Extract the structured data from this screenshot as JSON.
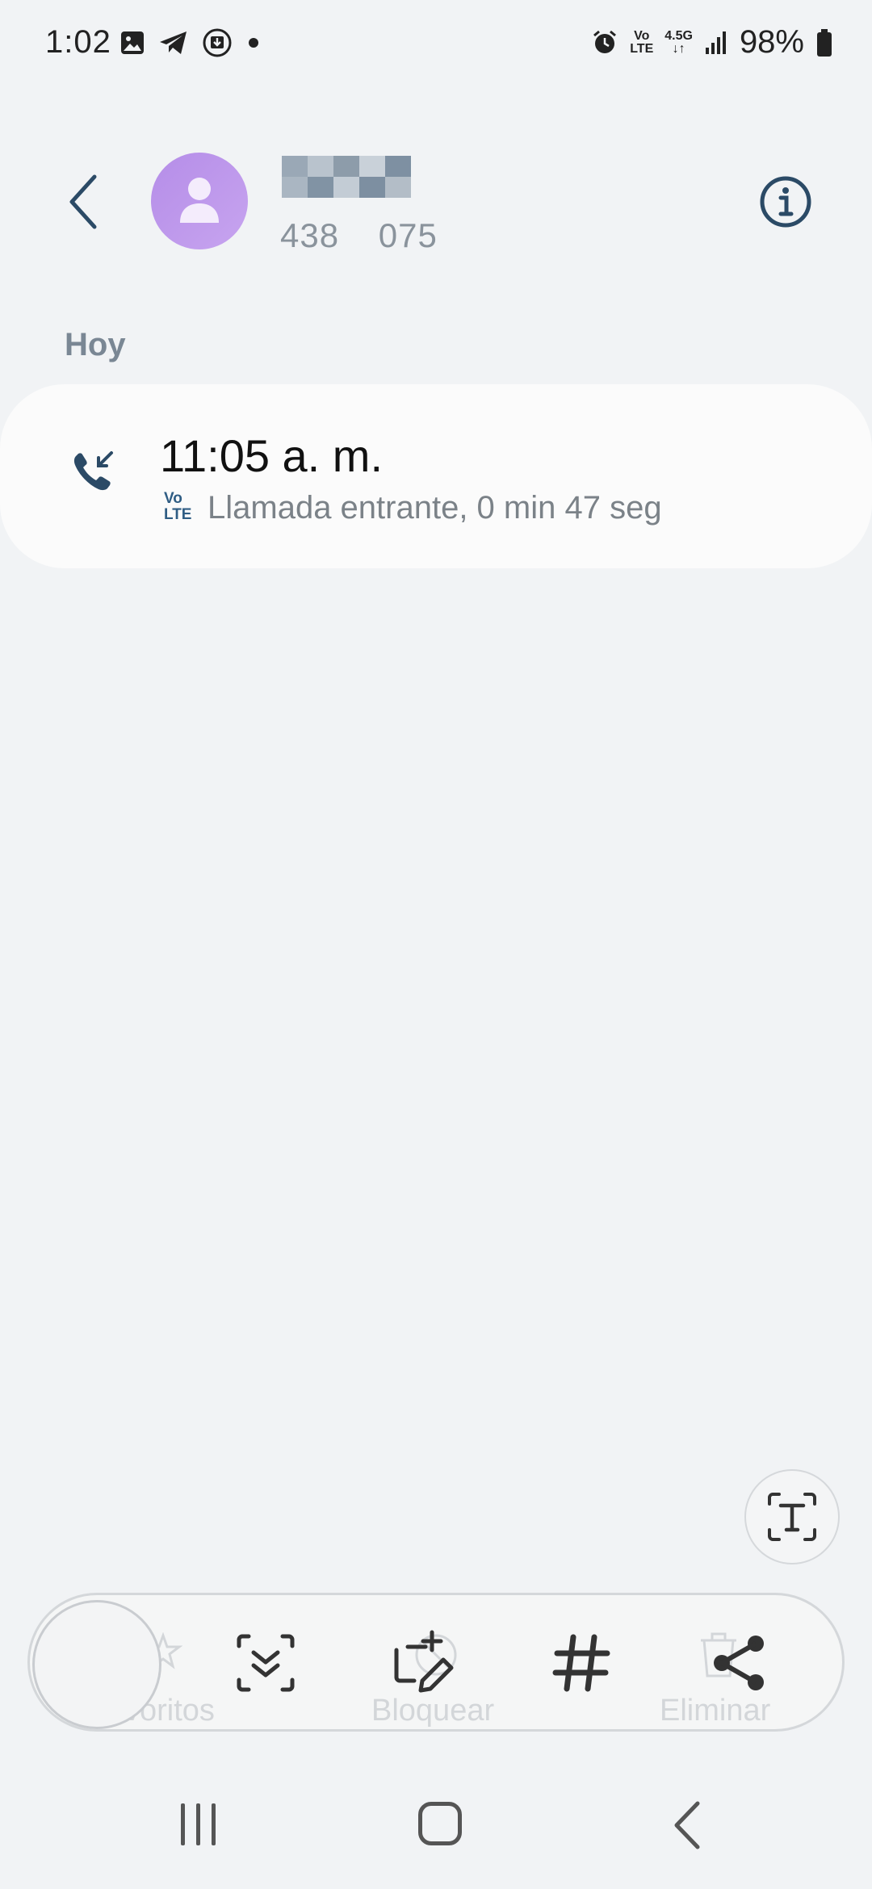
{
  "status_bar": {
    "time": "1:02",
    "volte_top": "Vo",
    "volte_bottom": "LTE",
    "network": "4.5G",
    "battery": "98%"
  },
  "header": {
    "contact_number": "438  075"
  },
  "section": {
    "label": "Hoy"
  },
  "call": {
    "time": "11:05 a. m.",
    "badge_top": "Vo",
    "badge_bottom": "LTE",
    "detail": "Llamada entrante, 0 min 47 seg"
  },
  "toolbar": {
    "favorites_label": "voritos",
    "block_label": "Bloquear",
    "delete_label": "Eliminar"
  },
  "colors": {
    "accent": "#2f5d84",
    "avatar": "#b58de8",
    "background": "#f1f3f5"
  }
}
